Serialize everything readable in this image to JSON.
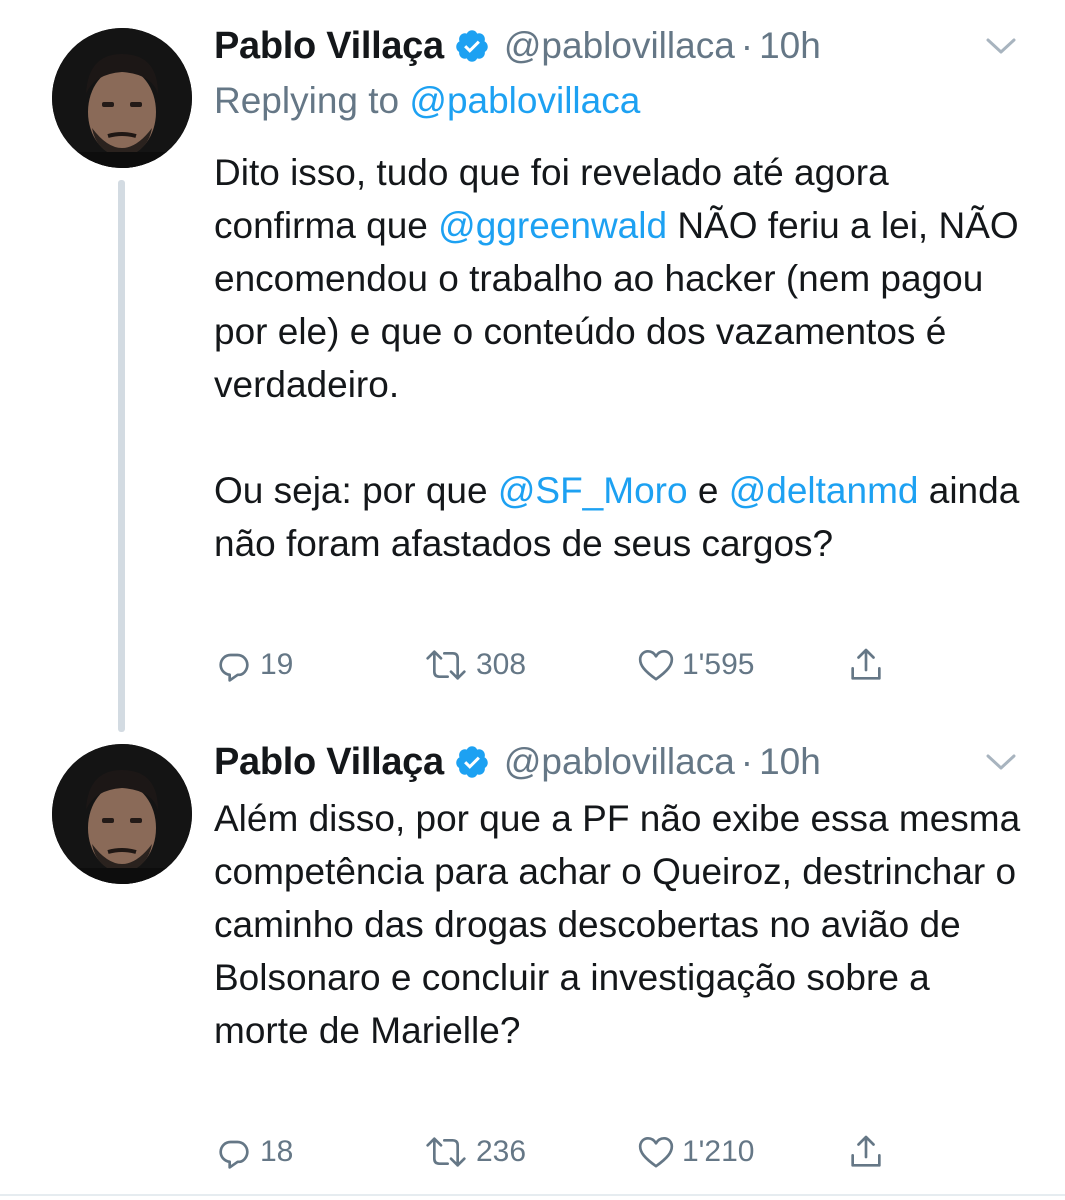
{
  "tweets": [
    {
      "display_name": "Pablo Villaça",
      "handle": "@pablovillaca",
      "separator": "·",
      "time": "10h",
      "replying_label": "Replying to",
      "replying_to": "@pablovillaca",
      "text": {
        "p1_a": "Dito isso, tudo que foi revelado até agora confirma que ",
        "p1_mention": "@ggreenwald",
        "p1_b": " NÃO feriu a lei, NÃO encomendou o trabalho ao hacker (nem pagou por ele) e que o conteúdo dos vazamentos é verdadeiro.",
        "p2_a": "Ou seja: por que ",
        "p2_mention1": "@SF_Moro",
        "p2_b": " e ",
        "p2_mention2": "@deltanmd",
        "p2_c": " ainda não foram afastados de seus cargos?"
      },
      "replies": "19",
      "retweets": "308",
      "likes": "1'595"
    },
    {
      "display_name": "Pablo Villaça",
      "handle": "@pablovillaca",
      "separator": "·",
      "time": "10h",
      "text": "Além disso, por que a PF não exibe essa mesma competência para achar o Queiroz, destrinchar o caminho das drogas descobertas no avião de Bolsonaro e concluir a investigação sobre a morte de Marielle?",
      "replies": "18",
      "retweets": "236",
      "likes": "1'210"
    }
  ],
  "icons": {
    "verified": "verified-badge-icon",
    "chevron": "chevron-down-icon",
    "reply": "reply-icon",
    "retweet": "retweet-icon",
    "like": "heart-icon",
    "share": "share-icon"
  },
  "colors": {
    "link": "#1da1f2",
    "secondary_text": "#657786",
    "primary_text": "#14171a",
    "thread_line": "#d3dbe2"
  }
}
